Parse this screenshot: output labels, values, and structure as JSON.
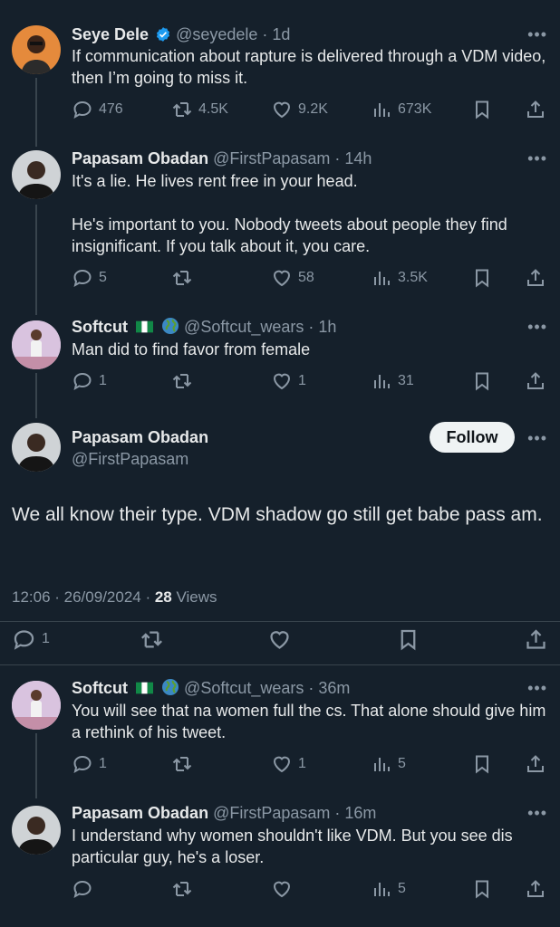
{
  "tweets": [
    {
      "name": "Seye Dele",
      "verified": true,
      "handle": "@seyedele",
      "time": "1d",
      "text": "If communication about rapture is delivered through a VDM video, then I’m going to miss it.",
      "replies": "476",
      "retweets": "4.5K",
      "likes": "9.2K",
      "views": "673K"
    },
    {
      "name": "Papasam Obadan",
      "handle": "@FirstPapasam",
      "time": "14h",
      "text1": "It's a lie. He lives rent free in your head.",
      "text2": "He's important to you. Nobody tweets about people they find insignificant. If you talk about it, you care.",
      "replies": "5",
      "retweets": "",
      "likes": "58",
      "views": "3.5K"
    },
    {
      "name": "Softcut",
      "handle": "@Softcut_wears",
      "time": "1h",
      "text": "Man did to find favor from female",
      "replies": "1",
      "retweets": "",
      "likes": "1",
      "views": "31"
    }
  ],
  "main_tweet": {
    "name": "Papasam Obadan",
    "handle": "@FirstPapasam",
    "follow_label": "Follow",
    "text": "We all know their type. VDM shadow go still get babe pass am.",
    "timestamp": "12:06 · 26/09/2024 · ",
    "views_count": "28",
    "views_label": " Views",
    "replies": "1"
  },
  "replies": [
    {
      "name": "Softcut",
      "handle": "@Softcut_wears",
      "time": "36m",
      "text": "You will see that na women full the cs. That alone should give him a rethink of his tweet.",
      "replies": "1",
      "retweets": "",
      "likes": "1",
      "views": "5"
    },
    {
      "name": "Papasam Obadan",
      "handle": "@FirstPapasam",
      "time": "16m",
      "text": "I understand why women shouldn't like VDM. But you see dis particular guy, he's a loser.",
      "replies": "",
      "retweets": "",
      "likes": "",
      "views": "5"
    }
  ],
  "dot_sep": " · ",
  "more_label": "•••",
  "colors": {
    "background": "#15202b",
    "text": "#e7e9ea",
    "muted": "#8b98a5",
    "verified": "#1d9bf0",
    "divider": "#38444d"
  }
}
